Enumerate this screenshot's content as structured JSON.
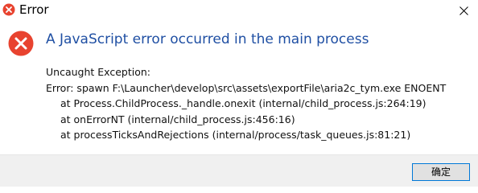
{
  "window": {
    "title": "Error",
    "icon": "error-icon",
    "close_icon": "close-icon"
  },
  "dialog": {
    "heading": "A JavaScript error occurred in the main process",
    "icon": "error-icon",
    "exception_label": "Uncaught Exception:",
    "error_line": "Error: spawn F:\\Launcher\\develop\\src\\assets\\exportFile\\aria2c_tym.exe ENOENT",
    "stack": [
      "at Process.ChildProcess._handle.onexit (internal/child_process.js:264:19)",
      "at onErrorNT (internal/child_process.js:456:16)",
      "at processTicksAndRejections (internal/process/task_queues.js:81:21)"
    ]
  },
  "footer": {
    "ok_label": "确定"
  },
  "colors": {
    "heading": "#1f4fa3",
    "error_red": "#e8432f",
    "button_border": "#0078d7",
    "footer_bg": "#f0f0f0"
  }
}
